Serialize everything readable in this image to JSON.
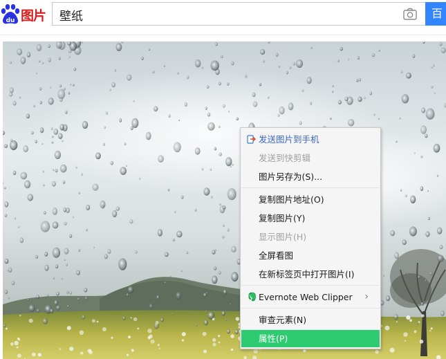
{
  "header": {
    "logo_text": "图片",
    "search_value": "壁纸",
    "search_button_label": "百"
  },
  "context_menu": {
    "items": [
      {
        "label": "发送图片到手机",
        "state": "normal",
        "icon": "send-to-phone-icon"
      },
      {
        "label": "发送到快剪辑",
        "state": "disabled"
      },
      {
        "label": "图片另存为(S)...",
        "state": "normal"
      },
      {
        "label": "复制图片地址(O)",
        "state": "normal"
      },
      {
        "label": "复制图片(Y)",
        "state": "normal"
      },
      {
        "label": "显示图片(H)",
        "state": "disabled"
      },
      {
        "label": "全屏看图",
        "state": "normal"
      },
      {
        "label": "在新标签页中打开图片(I)",
        "state": "normal"
      },
      {
        "label": "Evernote Web Clipper",
        "state": "normal",
        "icon": "evernote-icon",
        "submenu": true
      },
      {
        "label": "审查元素(N)",
        "state": "normal"
      },
      {
        "label": "属性(P)",
        "state": "highlighted"
      }
    ]
  },
  "colors": {
    "accent_blue": "#3385ff",
    "logo_red": "#de1b1b",
    "logo_blue": "#2932e1",
    "highlight_green": "#2ecc71"
  }
}
